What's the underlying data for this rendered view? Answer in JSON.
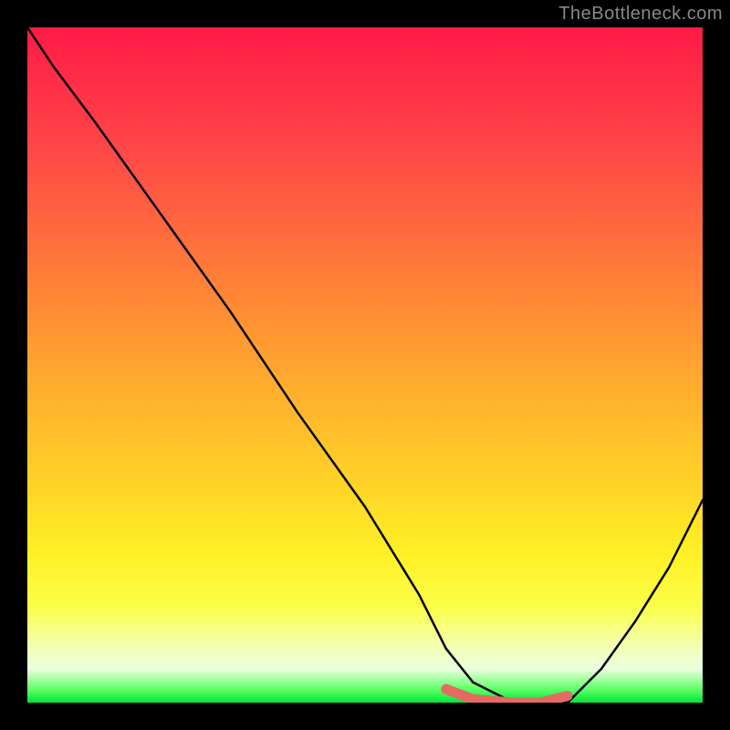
{
  "watermark": "TheBottleneck.com",
  "chart_data": {
    "type": "line",
    "title": "",
    "xlabel": "",
    "ylabel": "",
    "xlim": [
      0,
      100
    ],
    "ylim": [
      0,
      100
    ],
    "series": [
      {
        "name": "bottleneck-curve",
        "x": [
          0,
          4,
          10,
          20,
          30,
          40,
          50,
          58,
          62,
          66,
          72,
          76,
          80,
          85,
          90,
          95,
          100
        ],
        "values": [
          100,
          94,
          86,
          72,
          58,
          43,
          29,
          16,
          8,
          3,
          0,
          0,
          0,
          5,
          12,
          20,
          30
        ]
      }
    ],
    "highlight": {
      "name": "optimal-range",
      "x": [
        62,
        66,
        72,
        76,
        80
      ],
      "values": [
        2,
        0.5,
        0,
        0,
        1
      ]
    },
    "gradient_stops": [
      {
        "pct": 0,
        "color": "#ff1a46"
      },
      {
        "pct": 18,
        "color": "#ff4748"
      },
      {
        "pct": 42,
        "color": "#ff8d35"
      },
      {
        "pct": 68,
        "color": "#ffd427"
      },
      {
        "pct": 86,
        "color": "#fbff4a"
      },
      {
        "pct": 98,
        "color": "#5fff66"
      },
      {
        "pct": 100,
        "color": "#00e637"
      }
    ]
  }
}
